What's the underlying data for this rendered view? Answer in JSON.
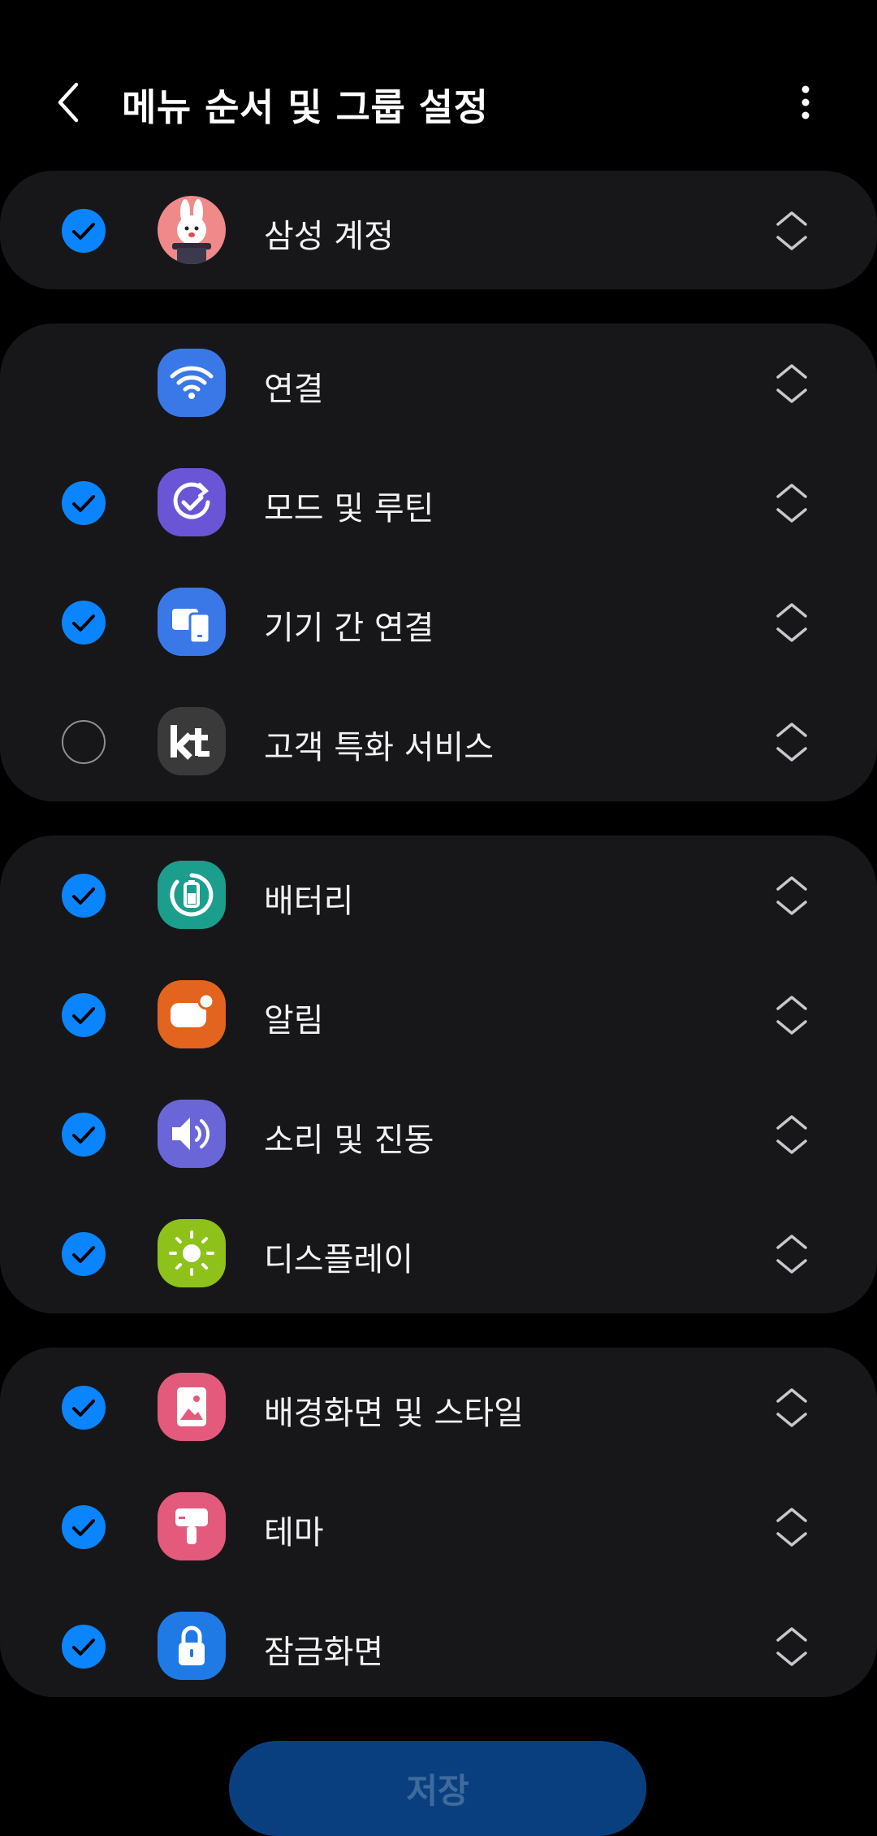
{
  "header": {
    "title": "메뉴 순서 및 그룹 설정"
  },
  "groups": [
    {
      "items": [
        {
          "label": "삼성 계정",
          "checked": true,
          "icon": "samsung-account-avatar-icon",
          "icon_bg": "#f08a8a"
        }
      ]
    },
    {
      "items": [
        {
          "label": "연결",
          "checked": null,
          "icon": "wifi-icon",
          "icon_bg": "#3a78e8"
        },
        {
          "label": "모드 및 루틴",
          "checked": true,
          "icon": "routine-check-icon",
          "icon_bg": "#6a55d6"
        },
        {
          "label": "기기 간 연결",
          "checked": true,
          "icon": "devices-icon",
          "icon_bg": "#3a78e8"
        },
        {
          "label": "고객 특화 서비스",
          "checked": false,
          "icon": "kt-icon",
          "icon_bg": "#3b3a3a"
        }
      ]
    },
    {
      "items": [
        {
          "label": "배터리",
          "checked": true,
          "icon": "battery-icon",
          "icon_bg": "#1c9e8c"
        },
        {
          "label": "알림",
          "checked": true,
          "icon": "notification-icon",
          "icon_bg": "#e3641e"
        },
        {
          "label": "소리 및 진동",
          "checked": true,
          "icon": "sound-icon",
          "icon_bg": "#6a66d8"
        },
        {
          "label": "디스플레이",
          "checked": true,
          "icon": "display-brightness-icon",
          "icon_bg": "#8ec21a"
        }
      ]
    },
    {
      "items": [
        {
          "label": "배경화면 및 스타일",
          "checked": true,
          "icon": "wallpaper-icon",
          "icon_bg": "#e45a7c"
        },
        {
          "label": "테마",
          "checked": true,
          "icon": "theme-brush-icon",
          "icon_bg": "#e45a7c"
        },
        {
          "label": "잠금화면",
          "checked": true,
          "icon": "lock-icon",
          "icon_bg": "#1f7ae6"
        }
      ]
    }
  ],
  "footer": {
    "save_label": "저장"
  },
  "colors": {
    "background": "#000000",
    "group_bg": "#17171a",
    "accent": "#0a84ff",
    "save_bg": "#0a3f7f"
  }
}
